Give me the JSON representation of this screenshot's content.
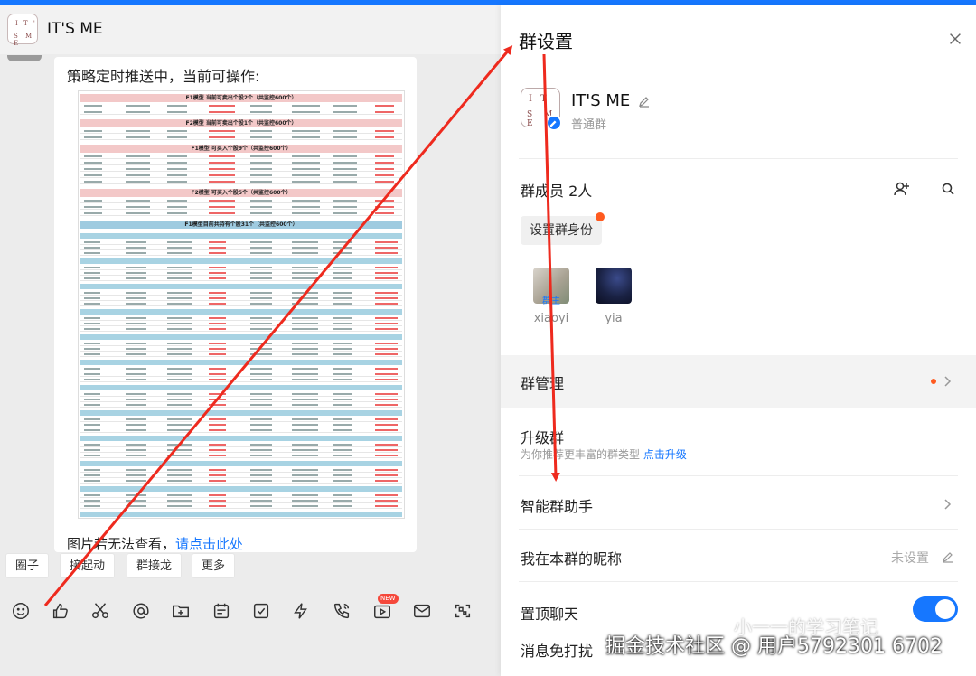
{
  "chat": {
    "title": "IT'S ME",
    "logo_top": "I T '",
    "logo_bottom": "S M E",
    "message_title": "策略定时推送中，当前可操作:",
    "message_foot": "图片若无法查看，",
    "message_link": "请点击此处",
    "doc_bands": [
      "F1模型 当前可卖出个股2个（共监控600个）",
      "F2模型 当前可卖出个股1个（共监控600个）",
      "F1模型 可买入个股9个（共监控600个）",
      "F2模型 可买入个股5个（共监控600个）",
      "F1模型目前共持有个股31个（共监控600个）"
    ],
    "quick_actions": [
      "圈子",
      "接起动",
      "群接龙",
      "更多"
    ],
    "toolbar_badge": "NEW"
  },
  "panel": {
    "title": "群设置",
    "group_name": "IT'S ME",
    "group_type": "普通群",
    "members_title": "群成员 2人",
    "role_button": "设置群身份",
    "members": [
      {
        "name": "xiaoyi",
        "tag": "群主"
      },
      {
        "name": "yia",
        "tag": ""
      }
    ],
    "management": "群管理",
    "upgrade_title": "升级群",
    "upgrade_sub": "为你推荐更丰富的群类型",
    "upgrade_link": "点击升级",
    "assistant": "智能群助手",
    "nickname_label": "我在本群的昵称",
    "nickname_value": "未设置",
    "pin_label": "置顶聊天",
    "pin_on": true,
    "mute_label": "消息免打扰"
  },
  "watermark": {
    "main": "掘金技术社区 @ 用户5792301 6702",
    "secondary": "小一一的学习笔记"
  },
  "colors": {
    "accent": "#1677ff",
    "arrow": "#ee2a1e",
    "dot": "#ff5a1f"
  }
}
